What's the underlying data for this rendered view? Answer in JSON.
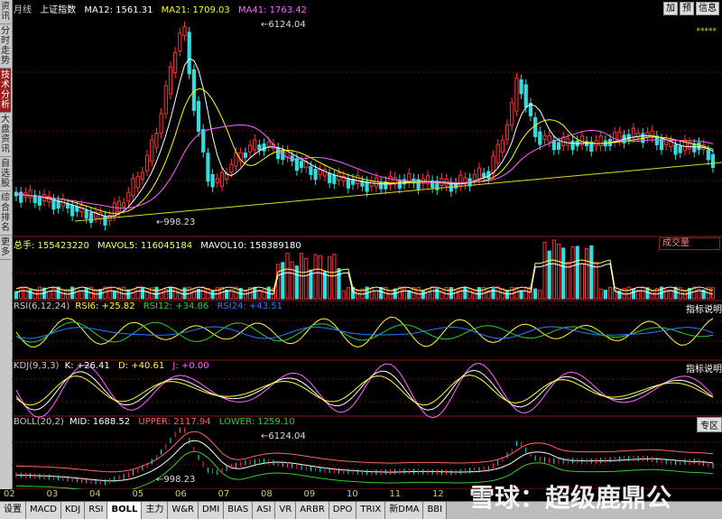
{
  "sidebar": {
    "tabs": [
      {
        "label": "资讯",
        "active": false
      },
      {
        "label": "分时走势",
        "active": false
      },
      {
        "label": "技术分析",
        "active": true
      },
      {
        "label": "大盘资讯",
        "active": false
      },
      {
        "label": "自选股",
        "active": false
      },
      {
        "label": "综合排名",
        "active": false
      },
      {
        "label": "更多",
        "active": false
      }
    ]
  },
  "main": {
    "period": "月线",
    "name": "上证指数",
    "ma12": "MA12: 1561.31",
    "ma21": "MA21: 1709.03",
    "ma41": "MA41: 1763.42",
    "high_label": "6124.04",
    "low_label": "998.23",
    "top_buttons": [
      "加",
      "预",
      "信息"
    ],
    "stars": "*****",
    "colors": {
      "ma12": "#ffffff",
      "ma21": "#ffff00",
      "ma41": "#ff66ff",
      "up": "#ff3333",
      "down": "#33dddd"
    }
  },
  "volume": {
    "total": "总手: 155423220",
    "mavol5": "MAVOL5: 116045184",
    "mavol10": "MAVOL10: 158389180",
    "button": "成交量"
  },
  "rsi": {
    "title": "RSI(6,12,24)",
    "rsi6": "RSI6: +25.82",
    "rsi12": "RSI12: +34.86",
    "rsi24": "RSI24: +43.51",
    "button": "指标说明"
  },
  "kdj": {
    "title": "KDJ(9,3,3)",
    "k": "K: +26.41",
    "d": "D: +40.61",
    "j": "J: +0.00",
    "button": "指标说明"
  },
  "boll": {
    "title": "BOLL(20,2)",
    "mid": "MID: 1688.52",
    "upper": "UPPER: 2117.94",
    "lower": "LOWER: 1259.10",
    "high_label": "6124.04",
    "low_label": "998.23",
    "button": "专区"
  },
  "xaxis": [
    "02",
    "03",
    "04",
    "05",
    "06",
    "07",
    "08",
    "09",
    "10",
    "11",
    "12"
  ],
  "bottom_tabs": [
    {
      "label": "设置",
      "active": false
    },
    {
      "label": "MACD",
      "active": false
    },
    {
      "label": "KDJ",
      "active": false
    },
    {
      "label": "RSI",
      "active": false
    },
    {
      "label": "BOLL",
      "active": true
    },
    {
      "label": "主力",
      "active": false
    },
    {
      "label": "W&R",
      "active": false
    },
    {
      "label": "DMI",
      "active": false
    },
    {
      "label": "BIAS",
      "active": false
    },
    {
      "label": "ASI",
      "active": false
    },
    {
      "label": "VR",
      "active": false
    },
    {
      "label": "ARBR",
      "active": false
    },
    {
      "label": "DPO",
      "active": false
    },
    {
      "label": "TRIX",
      "active": false
    },
    {
      "label": "新DMA",
      "active": false
    },
    {
      "label": "BBI",
      "active": false
    }
  ],
  "watermark": "雪球：超级鹿鼎公"
}
